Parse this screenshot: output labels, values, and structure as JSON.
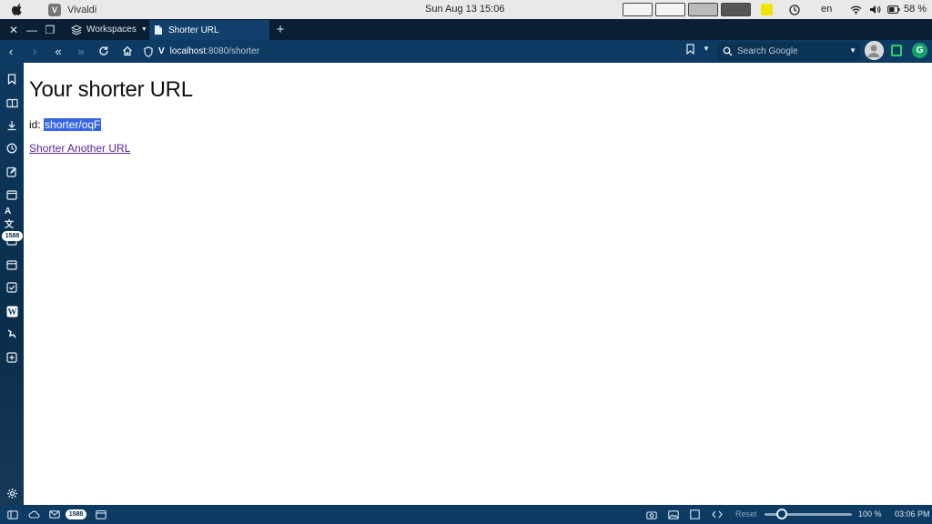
{
  "system_bar": {
    "app_name": "Vivaldi",
    "clock": "Sun Aug 13  15:06",
    "language": "en",
    "battery": "58 %"
  },
  "tab_bar": {
    "workspaces_label": "Workspaces",
    "active_tab_title": "Shorter URL",
    "new_tab_symbol": "+"
  },
  "address_bar": {
    "url_host": "localhost",
    "url_path": ":8080/shorter",
    "search_placeholder": "Search Google"
  },
  "sidebar": {
    "badge_count": "1588",
    "icons": [
      "bookmark-icon",
      "reading-list-icon",
      "downloads-icon",
      "history-icon",
      "notes-icon",
      "window-icon",
      "translate-icon",
      "mail-icon",
      "calendar-icon",
      "tasks-icon",
      "wikipedia-icon",
      "feed-icon",
      "add-panel-icon",
      "settings-icon"
    ]
  },
  "page": {
    "heading": "Your shorter URL",
    "id_label": "id: ",
    "id_value": "shorter/oqF",
    "link_text": "Shorter Another URL"
  },
  "status_bar": {
    "mail_badge": "1588",
    "reset_label": "Reset",
    "zoom_level": "100 %",
    "time": "03:06 PM"
  },
  "colors": {
    "chrome_dark": "#0a1f33",
    "chrome_blue": "#0d3b63",
    "selection": "#3465e4",
    "visited_link": "#5b1f9a"
  }
}
